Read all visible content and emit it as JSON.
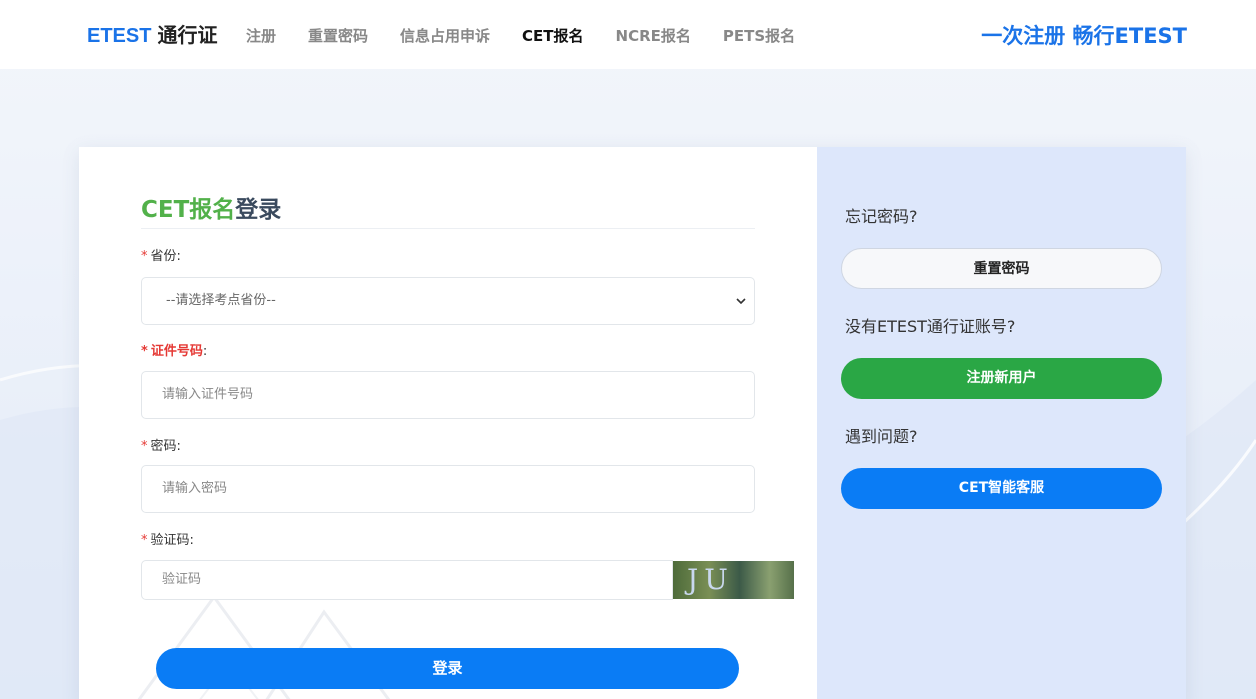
{
  "header": {
    "brand_primary": "ETEST",
    "brand_secondary": "通行证",
    "nav": [
      {
        "label": "注册",
        "active": false
      },
      {
        "label": "重置密码",
        "active": false
      },
      {
        "label": "信息占用申诉",
        "active": false
      },
      {
        "label": "CET报名",
        "active": true
      },
      {
        "label": "NCRE报名",
        "active": false
      },
      {
        "label": "PETS报名",
        "active": false
      }
    ],
    "slogan": "一次注册 畅行ETEST"
  },
  "login": {
    "title_highlight": "CET报名",
    "title_rest": "登录",
    "required_mark": "*",
    "colon": ":",
    "province": {
      "label": "省份",
      "selected": "--请选择考点省份--"
    },
    "id_number": {
      "label": "证件号码",
      "placeholder": "请输入证件号码"
    },
    "password": {
      "label": "密码",
      "placeholder": "请输入密码"
    },
    "captcha": {
      "label": "验证码",
      "placeholder": "验证码",
      "image_text": "JU QX"
    },
    "submit_label": "登录"
  },
  "side": {
    "forgot_text": "忘记密码?",
    "reset_label": "重置密码",
    "no_account_text": "没有ETEST通行证账号?",
    "register_label": "注册新用户",
    "problem_text": "遇到问题?",
    "service_label": "CET智能客服"
  },
  "colors": {
    "brand_blue": "#1a73e8",
    "title_green": "#52b14a",
    "register_green": "#2aa745",
    "primary_button": "#0a7cf5",
    "required_red": "#e53935",
    "side_panel": "#dde7fb"
  }
}
